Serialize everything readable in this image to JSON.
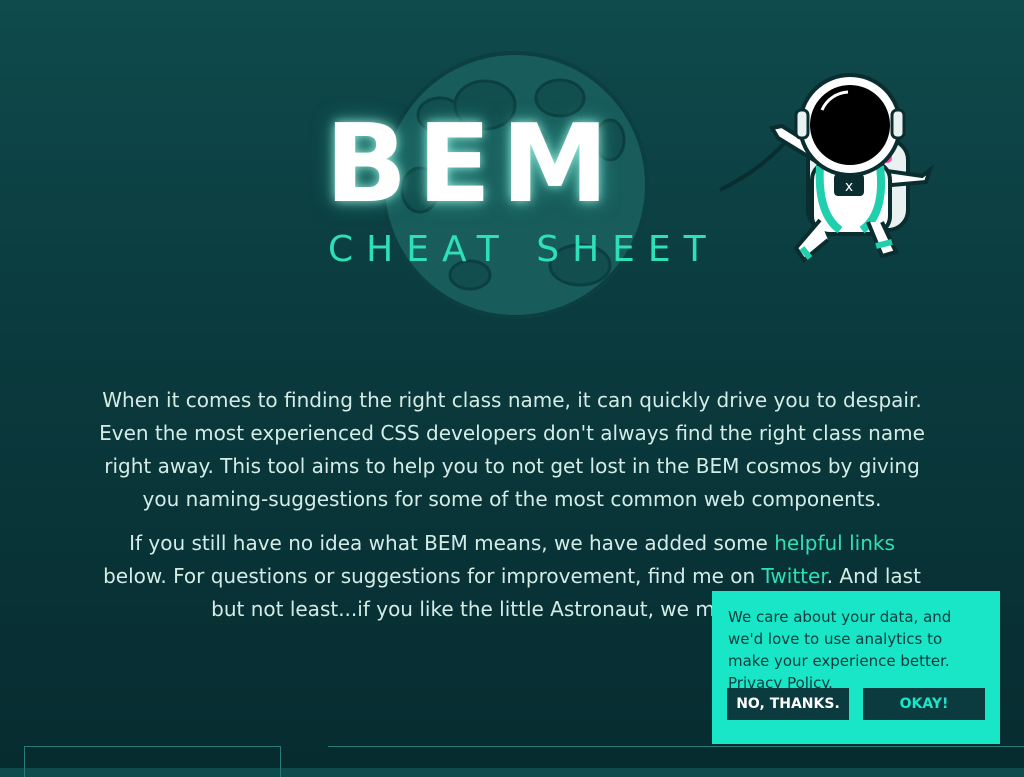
{
  "hero": {
    "title": "BEM",
    "subtitle": "CHEAT SHEET"
  },
  "intro": {
    "p1": "When it comes to finding the right class name, it can quickly drive you to despair. Even the most experienced CSS developers don't always find the right class name right away. This tool aims to help you to not get lost in the BEM cosmos by giving you naming-suggestions for some of the most common web components.",
    "p2_a": "If you still have no idea what BEM means, we have added some ",
    "p2_link1": "helpful links",
    "p2_b": " below. For questions or suggestions for improvement, find me on ",
    "p2_link2": "Twitter",
    "p2_c": ". And last but not least...if you like the little Astronaut, we made some"
  },
  "cookie": {
    "text": "We care about your data, and we'd love to use analytics to make your experience better. ",
    "link": "Privacy Policy",
    "after_link": ".",
    "decline": "NO, THANKS.",
    "accept": "OKAY!"
  },
  "colors": {
    "accent": "#2ee0b8",
    "banner": "#18e6c6",
    "dark": "#0b3b3e"
  }
}
